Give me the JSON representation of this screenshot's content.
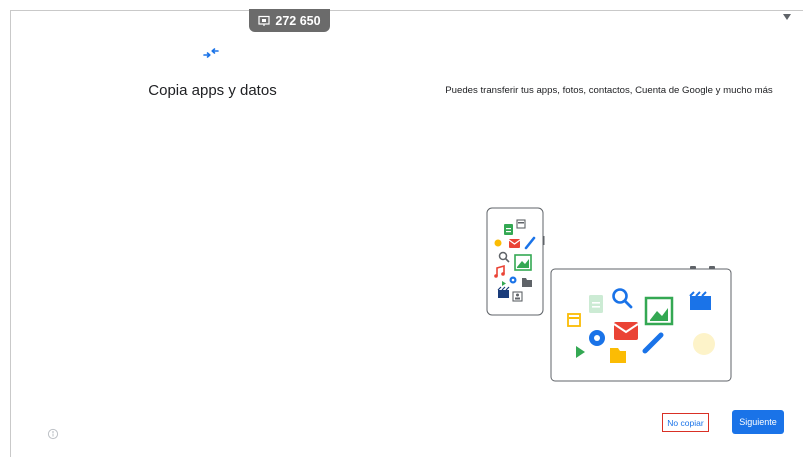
{
  "session": {
    "code": "272 650",
    "icon": "cast-screen-icon"
  },
  "header": {
    "corner_icon": "caret-down-icon",
    "transfer_icon": "transfer-arrows-icon"
  },
  "main": {
    "title": "Copia apps y datos",
    "description": "Puedes transferir tus apps, fotos, contactos, Cuenta de Google y mucho más"
  },
  "illustration": {
    "phone_icons": [
      "document-icon",
      "calendar-icon",
      "mail-icon",
      "pencil-icon",
      "search-icon",
      "image-icon",
      "music-icon",
      "play-icon",
      "gear-icon",
      "folder-icon",
      "video-icon",
      "contact-icon"
    ],
    "tablet_icons": [
      "document-icon",
      "search-icon",
      "image-icon",
      "video-icon",
      "calendar-icon",
      "gear-icon",
      "mail-icon",
      "pencil-icon",
      "play-icon",
      "folder-icon",
      "circle-icon"
    ]
  },
  "footer": {
    "accessibility_icon": "accessibility-icon",
    "skip_label": "No copiar",
    "next_label": "Siguiente"
  },
  "colors": {
    "accent": "#1a73e8",
    "pill": "#6b6b6b",
    "skip_border": "#d93025"
  }
}
